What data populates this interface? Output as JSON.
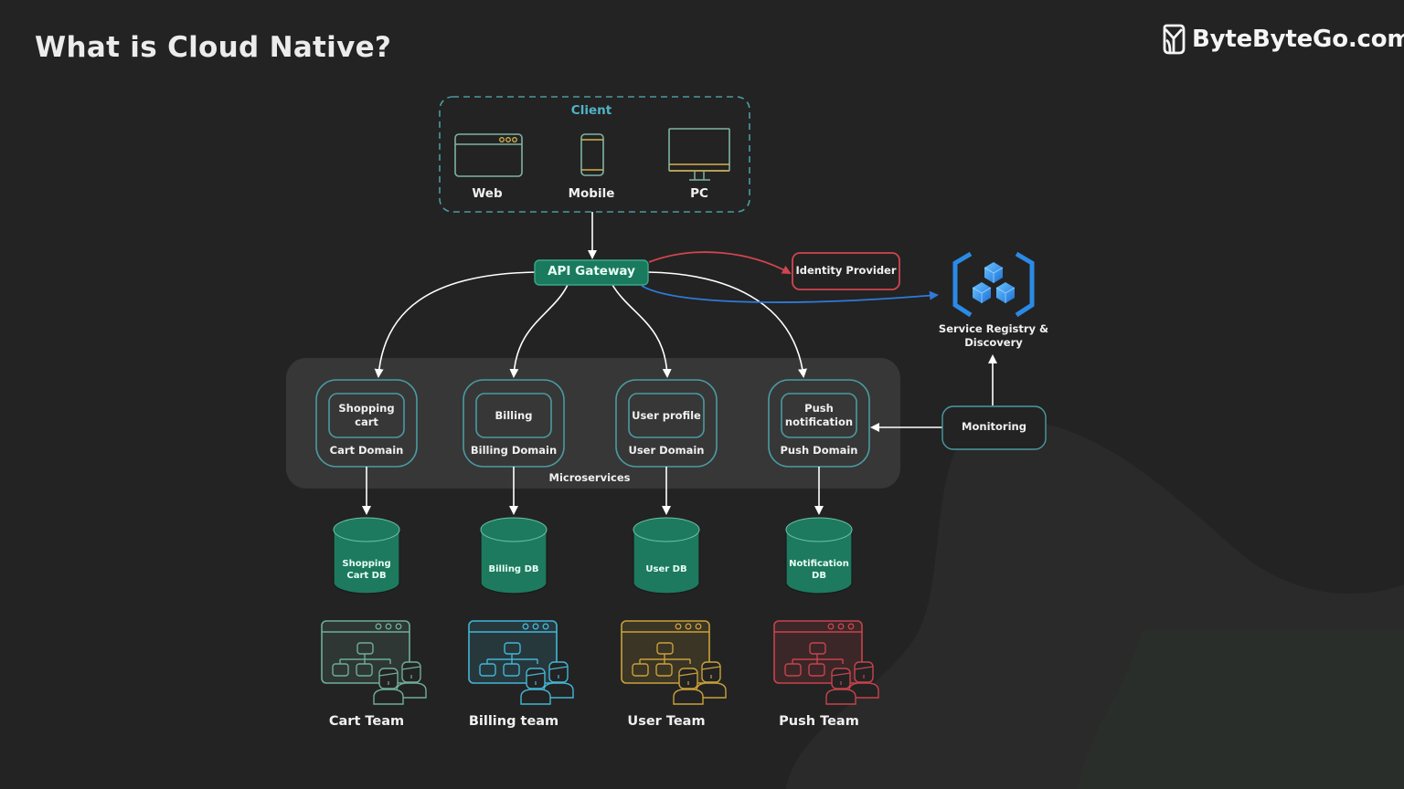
{
  "header": {
    "title": "What is Cloud Native?",
    "brand": "ByteByteGo.com",
    "brand_icon": "bytebytego-logo-icon"
  },
  "colors": {
    "background": "#232323",
    "panel": "#373737",
    "teal": "#4a9aa0",
    "green": "#1d7a5e",
    "red": "#d0454f",
    "blue": "#2f7ad8",
    "gold": "#c9a13a",
    "cyan": "#3aa8d8",
    "client_title": "#4fb3c9"
  },
  "client": {
    "title": "Client",
    "devices": [
      {
        "label": "Web",
        "icon": "browser-window-icon"
      },
      {
        "label": "Mobile",
        "icon": "mobile-phone-icon"
      },
      {
        "label": "PC",
        "icon": "desktop-monitor-icon"
      }
    ]
  },
  "gateway": {
    "label": "API Gateway"
  },
  "identity": {
    "label": "Identity Provider"
  },
  "registry": {
    "label_line1": "Service Registry &",
    "label_line2": "Discovery",
    "icon": "cubes-registry-icon"
  },
  "monitoring": {
    "label": "Monitoring"
  },
  "microservices": {
    "label": "Microservices",
    "domains": [
      {
        "service_line1": "Shopping",
        "service_line2": "cart",
        "domain": "Cart Domain",
        "db_line1": "Shopping",
        "db_line2": "Cart DB",
        "team": "Cart Team",
        "team_color": "#6fae98"
      },
      {
        "service_line1": "Billing",
        "service_line2": "",
        "domain": "Billing Domain",
        "db_line1": "Billing DB",
        "db_line2": "",
        "team": "Billing team",
        "team_color": "#43b6d6"
      },
      {
        "service_line1": "User profile",
        "service_line2": "",
        "domain": "User Domain",
        "db_line1": "User DB",
        "db_line2": "",
        "team": "User Team",
        "team_color": "#c9a13a"
      },
      {
        "service_line1": "Push",
        "service_line2": "notification",
        "domain": "Push Domain",
        "db_line1": "Notification",
        "db_line2": "DB",
        "team": "Push Team",
        "team_color": "#c8434c"
      }
    ]
  }
}
